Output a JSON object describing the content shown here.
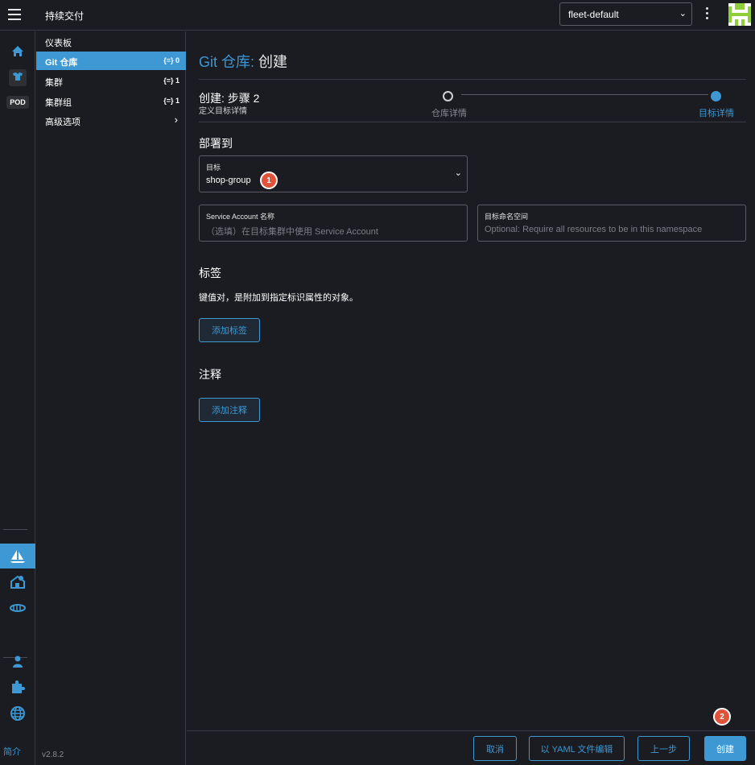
{
  "header": {
    "app_title": "持续交付",
    "workspace": "fleet-default"
  },
  "rail": {
    "pod_label": "POD",
    "footer_label": "简介"
  },
  "sidenav": {
    "items": [
      {
        "label": "仪表板",
        "count": ""
      },
      {
        "label": "Git 仓库",
        "count": "0"
      },
      {
        "label": "集群",
        "count": "1"
      },
      {
        "label": "集群组",
        "count": "1"
      },
      {
        "label": "高级选项",
        "count": ""
      }
    ],
    "version": "v2.8.2"
  },
  "page": {
    "title_crumb": "Git 仓库:",
    "title_action": "创建",
    "step_title": "创建: 步骤 2",
    "step_subtitle": "定义目标详情",
    "steps": [
      {
        "label": "仓库详情",
        "state": "done"
      },
      {
        "label": "目标详情",
        "state": "active"
      }
    ],
    "deploy_heading": "部署到",
    "target_field": {
      "label": "目标",
      "value": "shop-group"
    },
    "service_account_field": {
      "label": "Service Account 名称",
      "placeholder": "（选填）在目标集群中使用 Service Account"
    },
    "namespace_field": {
      "label": "目标命名空间",
      "placeholder": "Optional: Require all resources to be in this namespace"
    },
    "labels_heading": "标签",
    "labels_desc": "键值对，是附加到指定标识属性的对象。",
    "add_label_button": "添加标签",
    "annotations_heading": "注释",
    "add_annotation_button": "添加注释"
  },
  "footer": {
    "cancel": "取消",
    "edit_yaml": "以 YAML 文件编辑",
    "previous": "上一步",
    "create": "创建"
  },
  "badges": [
    "1",
    "2"
  ],
  "colors": {
    "accent": "#3d98d3",
    "badge": "#e0523a",
    "background": "#1b1c21"
  }
}
